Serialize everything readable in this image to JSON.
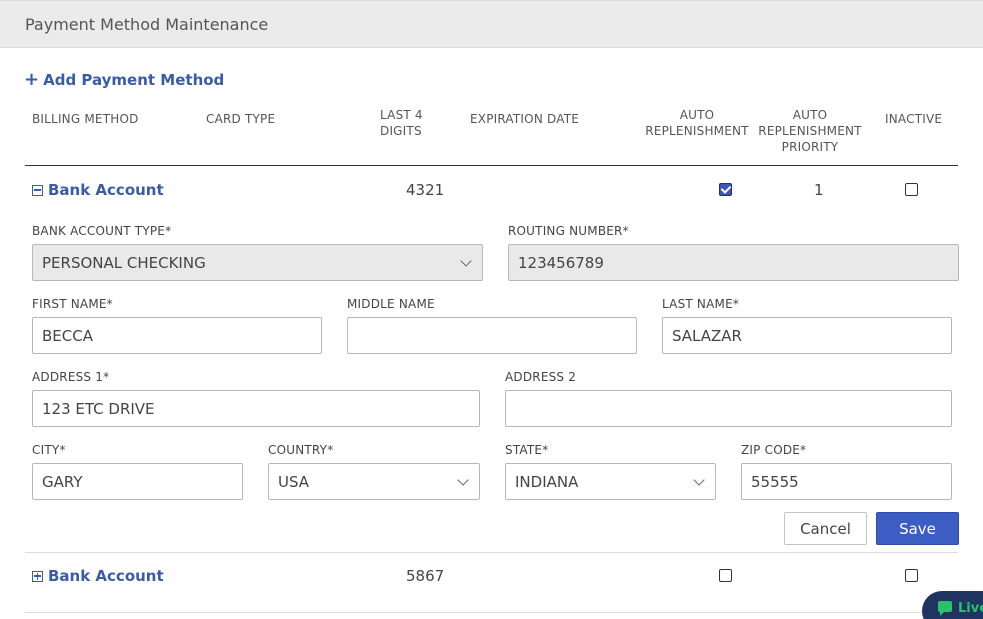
{
  "header": {
    "title": "Payment Method Maintenance"
  },
  "add_link": {
    "label": "Add Payment Method",
    "icon": "plus-icon"
  },
  "columns": {
    "billing_method": "BILLING METHOD",
    "card_type": "CARD TYPE",
    "last4_l1": "LAST 4",
    "last4_l2": "DIGITS",
    "expiration": "EXPIRATION DATE",
    "auto_l1": "AUTO",
    "auto_l2": "REPLENISHMENT",
    "prio_l1": "AUTO",
    "prio_l2": "REPLENISHMENT",
    "prio_l3": "PRIORITY",
    "inactive": "INACTIVE"
  },
  "rows": [
    {
      "title": "Bank Account",
      "expanded": true,
      "last4": "4321",
      "auto_replenishment": true,
      "priority": "1",
      "inactive": false
    },
    {
      "title": "Bank Account",
      "expanded": false,
      "last4": "5867",
      "auto_replenishment": false,
      "priority": "",
      "inactive": false
    }
  ],
  "form": {
    "bank_account_type": {
      "label": "BANK ACCOUNT TYPE*",
      "value": "PERSONAL CHECKING"
    },
    "routing_number": {
      "label": "ROUTING NUMBER*",
      "value": "123456789"
    },
    "first_name": {
      "label": "FIRST NAME*",
      "value": "BECCA"
    },
    "middle_name": {
      "label": "MIDDLE NAME",
      "value": ""
    },
    "last_name": {
      "label": "LAST NAME*",
      "value": "SALAZAR"
    },
    "address1": {
      "label": "ADDRESS 1*",
      "value": "123 ETC DRIVE"
    },
    "address2": {
      "label": "ADDRESS 2",
      "value": ""
    },
    "city": {
      "label": "CITY*",
      "value": "GARY"
    },
    "country": {
      "label": "COUNTRY*",
      "value": "USA"
    },
    "state": {
      "label": "STATE*",
      "value": "INDIANA"
    },
    "zip": {
      "label": "ZIP CODE*",
      "value": "55555"
    },
    "cancel_label": "Cancel",
    "save_label": "Save"
  },
  "live_chat": {
    "label": "Live"
  },
  "colors": {
    "accent": "#3a5ca8",
    "save_button": "#3c5dc4",
    "chat_bg": "#1f3460",
    "chat_fg": "#27c26a"
  }
}
